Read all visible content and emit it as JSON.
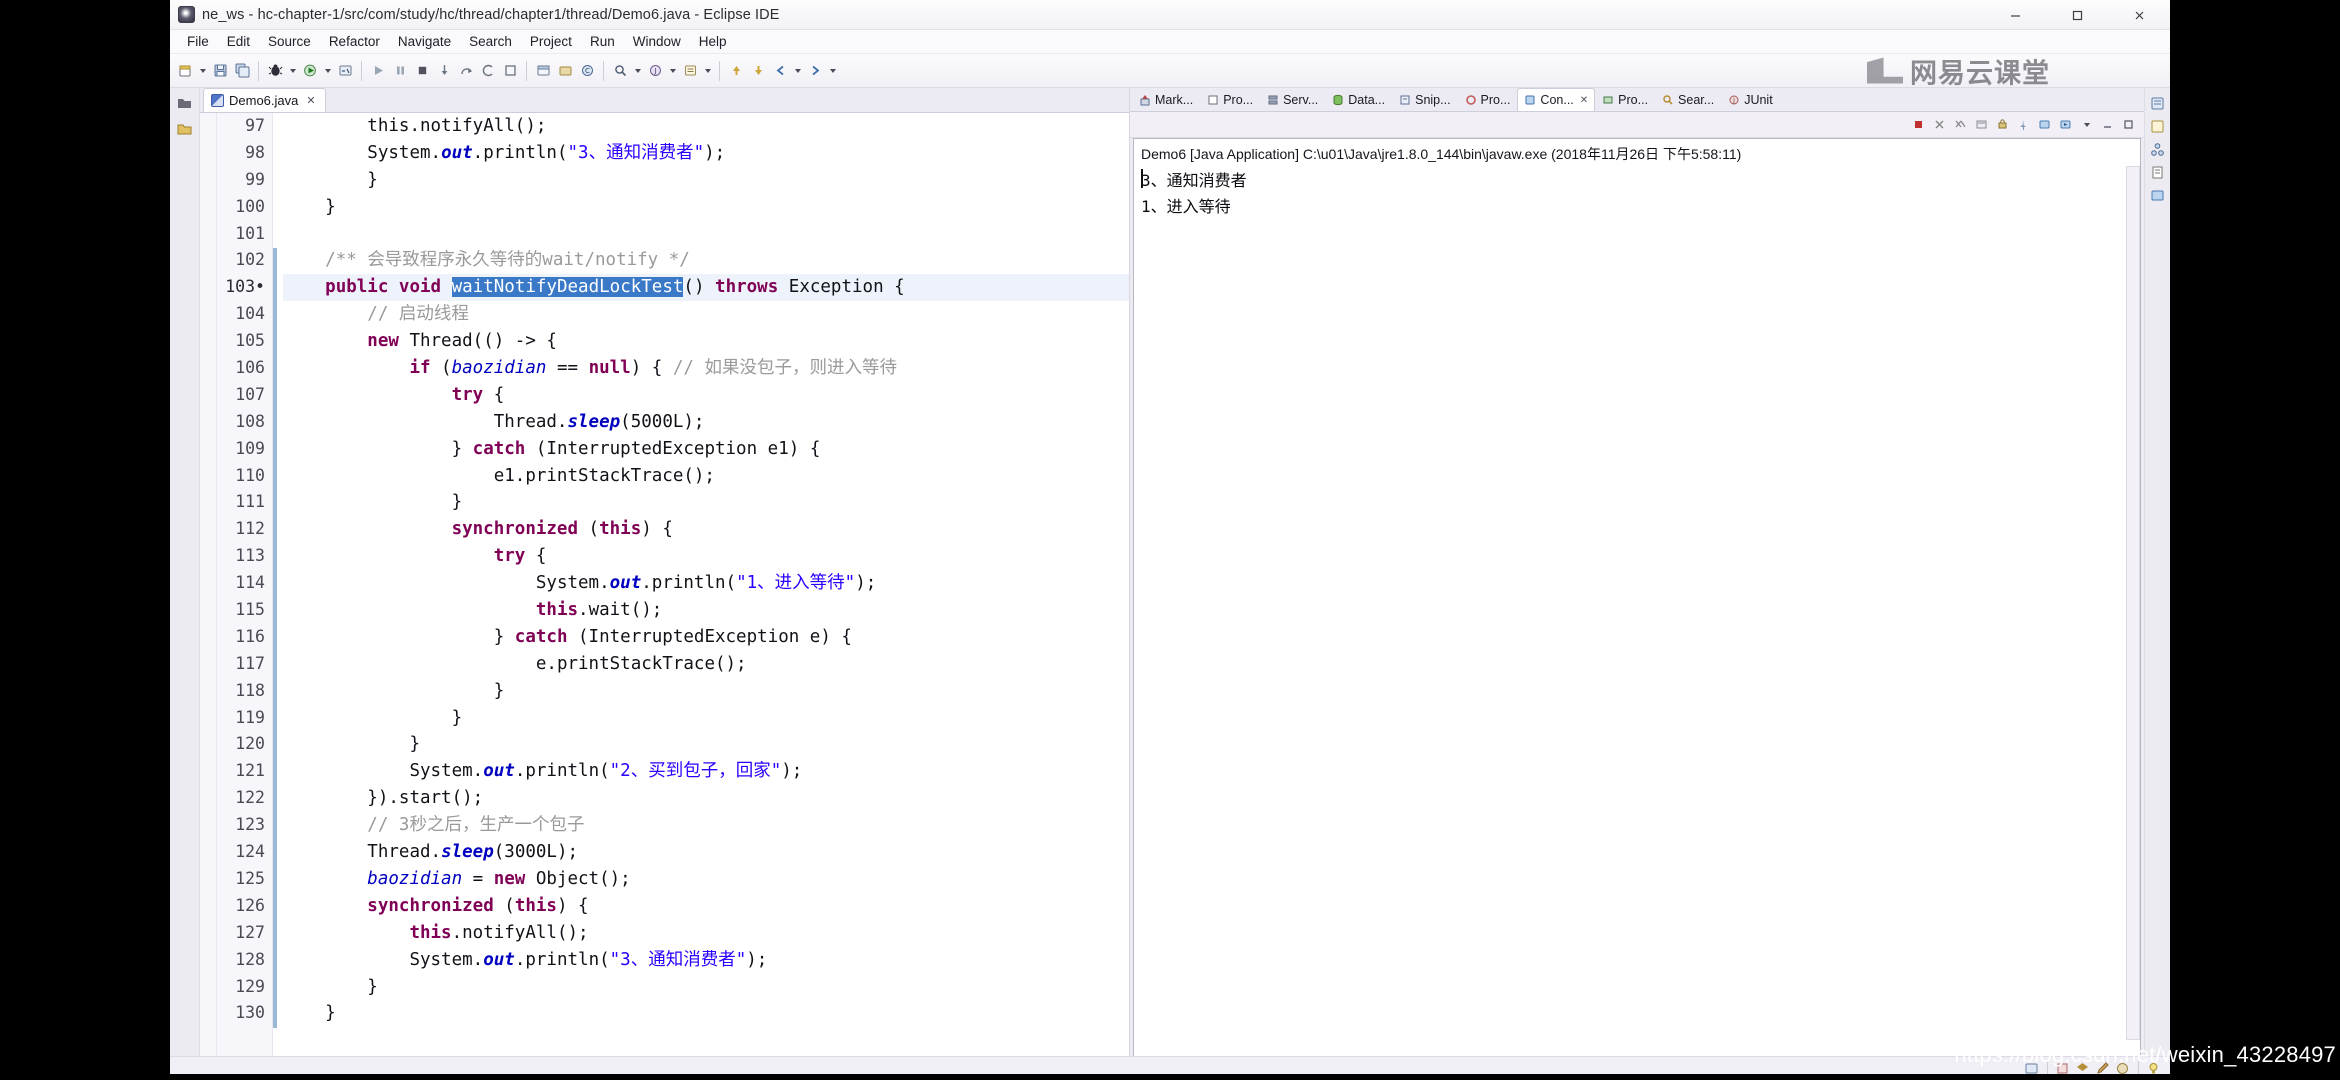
{
  "window": {
    "title": "ne_ws - hc-chapter-1/src/com/study/hc/thread/chapter1/thread/Demo6.java - Eclipse IDE",
    "app_icon": "eclipse-icon",
    "minimize": "—",
    "maximize": "☐",
    "close": "✕"
  },
  "menubar": {
    "items": [
      {
        "label": "File"
      },
      {
        "label": "Edit"
      },
      {
        "label": "Source"
      },
      {
        "label": "Refactor"
      },
      {
        "label": "Navigate"
      },
      {
        "label": "Search"
      },
      {
        "label": "Project"
      },
      {
        "label": "Run"
      },
      {
        "label": "Window"
      },
      {
        "label": "Help"
      }
    ]
  },
  "watermarks": {
    "brand_text": "网易云课堂",
    "brand_icon": "open-book-icon",
    "blog_url": "https://blog.csdn.net/weixin_43228497"
  },
  "editor": {
    "tab": {
      "label": "Demo6.java",
      "icon": "java-file-icon",
      "close": "✕"
    },
    "selected_text": "waitNotifyDeadLockTest",
    "lines": [
      {
        "num": "97",
        "marker": "",
        "indent": 2,
        "tokens": [
          {
            "t": "this.",
            "c": "cl"
          },
          {
            "t": "notifyAll();",
            "c": "cl"
          }
        ]
      },
      {
        "num": "98",
        "marker": "",
        "indent": 2,
        "tokens": [
          {
            "t": "System.",
            "c": "cl"
          },
          {
            "t": "out",
            "c": "stc"
          },
          {
            "t": ".println(",
            "c": "cl"
          },
          {
            "t": "\"3、通知消费者\"",
            "c": "str"
          },
          {
            "t": ");",
            "c": "cl"
          }
        ]
      },
      {
        "num": "99",
        "marker": "",
        "indent": 2,
        "tokens": [
          {
            "t": "}",
            "c": "cl"
          }
        ]
      },
      {
        "num": "100",
        "marker": "",
        "indent": 1,
        "tokens": [
          {
            "t": "}",
            "c": "cl"
          }
        ]
      },
      {
        "num": "101",
        "marker": "",
        "indent": 0,
        "tokens": []
      },
      {
        "num": "102",
        "marker": "",
        "indent": 1,
        "tokens": [
          {
            "t": "/** ",
            "c": "doc"
          },
          {
            "t": "会导致程序永久等待的wait/notify */",
            "c": "doc"
          }
        ]
      },
      {
        "num": "103",
        "marker": "•",
        "indent": 1,
        "current": true,
        "tokens": [
          {
            "t": "public",
            "c": "kw"
          },
          {
            "t": " ",
            "c": "cl"
          },
          {
            "t": "void",
            "c": "kw"
          },
          {
            "t": " ",
            "c": "cl"
          },
          {
            "t": "waitNotifyDeadLockTest",
            "c": "sel"
          },
          {
            "t": "() ",
            "c": "cl"
          },
          {
            "t": "throws",
            "c": "kw"
          },
          {
            "t": " Exception {",
            "c": "cl"
          }
        ]
      },
      {
        "num": "104",
        "marker": "",
        "indent": 2,
        "tokens": [
          {
            "t": "// 启动线程",
            "c": "cmt"
          }
        ]
      },
      {
        "num": "105",
        "marker": "",
        "indent": 2,
        "tokens": [
          {
            "t": "new",
            "c": "kw"
          },
          {
            "t": " Thread(() -> {",
            "c": "cl"
          }
        ]
      },
      {
        "num": "106",
        "marker": "",
        "indent": 3,
        "tokens": [
          {
            "t": "if",
            "c": "kw"
          },
          {
            "t": " (",
            "c": "cl"
          },
          {
            "t": "baozidian",
            "c": "fld"
          },
          {
            "t": " == ",
            "c": "cl"
          },
          {
            "t": "null",
            "c": "kw"
          },
          {
            "t": ") { ",
            "c": "cl"
          },
          {
            "t": "// 如果没包子，则进入等待",
            "c": "cmt"
          }
        ]
      },
      {
        "num": "107",
        "marker": "",
        "indent": 4,
        "tokens": [
          {
            "t": "try",
            "c": "kw"
          },
          {
            "t": " {",
            "c": "cl"
          }
        ]
      },
      {
        "num": "108",
        "marker": "",
        "indent": 5,
        "tokens": [
          {
            "t": "Thread.",
            "c": "cl"
          },
          {
            "t": "sleep",
            "c": "stc"
          },
          {
            "t": "(5000L);",
            "c": "cl"
          }
        ]
      },
      {
        "num": "109",
        "marker": "",
        "indent": 4,
        "tokens": [
          {
            "t": "} ",
            "c": "cl"
          },
          {
            "t": "catch",
            "c": "kw"
          },
          {
            "t": " (InterruptedException e1) {",
            "c": "cl"
          }
        ]
      },
      {
        "num": "110",
        "marker": "",
        "indent": 5,
        "tokens": [
          {
            "t": "e1.printStackTrace();",
            "c": "cl"
          }
        ]
      },
      {
        "num": "111",
        "marker": "",
        "indent": 4,
        "tokens": [
          {
            "t": "}",
            "c": "cl"
          }
        ]
      },
      {
        "num": "112",
        "marker": "",
        "indent": 4,
        "tokens": [
          {
            "t": "synchronized",
            "c": "kw"
          },
          {
            "t": " (",
            "c": "cl"
          },
          {
            "t": "this",
            "c": "kw"
          },
          {
            "t": ") {",
            "c": "cl"
          }
        ]
      },
      {
        "num": "113",
        "marker": "",
        "indent": 5,
        "tokens": [
          {
            "t": "try",
            "c": "kw"
          },
          {
            "t": " {",
            "c": "cl"
          }
        ]
      },
      {
        "num": "114",
        "marker": "",
        "indent": 6,
        "tokens": [
          {
            "t": "System.",
            "c": "cl"
          },
          {
            "t": "out",
            "c": "stc"
          },
          {
            "t": ".println(",
            "c": "cl"
          },
          {
            "t": "\"1、进入等待\"",
            "c": "str"
          },
          {
            "t": ");",
            "c": "cl"
          }
        ]
      },
      {
        "num": "115",
        "marker": "",
        "indent": 6,
        "tokens": [
          {
            "t": "this",
            "c": "kw"
          },
          {
            "t": ".wait();",
            "c": "cl"
          }
        ]
      },
      {
        "num": "116",
        "marker": "",
        "indent": 5,
        "tokens": [
          {
            "t": "} ",
            "c": "cl"
          },
          {
            "t": "catch",
            "c": "kw"
          },
          {
            "t": " (InterruptedException e) {",
            "c": "cl"
          }
        ]
      },
      {
        "num": "117",
        "marker": "",
        "indent": 6,
        "tokens": [
          {
            "t": "e.printStackTrace();",
            "c": "cl"
          }
        ]
      },
      {
        "num": "118",
        "marker": "",
        "indent": 5,
        "tokens": [
          {
            "t": "}",
            "c": "cl"
          }
        ]
      },
      {
        "num": "119",
        "marker": "",
        "indent": 4,
        "tokens": [
          {
            "t": "}",
            "c": "cl"
          }
        ]
      },
      {
        "num": "120",
        "marker": "",
        "indent": 3,
        "tokens": [
          {
            "t": "}",
            "c": "cl"
          }
        ]
      },
      {
        "num": "121",
        "marker": "",
        "indent": 3,
        "tokens": [
          {
            "t": "System.",
            "c": "cl"
          },
          {
            "t": "out",
            "c": "stc"
          },
          {
            "t": ".println(",
            "c": "cl"
          },
          {
            "t": "\"2、买到包子，回家\"",
            "c": "str"
          },
          {
            "t": ");",
            "c": "cl"
          }
        ]
      },
      {
        "num": "122",
        "marker": "",
        "indent": 2,
        "tokens": [
          {
            "t": "}).start();",
            "c": "cl"
          }
        ]
      },
      {
        "num": "123",
        "marker": "",
        "indent": 2,
        "tokens": [
          {
            "t": "// 3秒之后，生产一个包子",
            "c": "cmt"
          }
        ]
      },
      {
        "num": "124",
        "marker": "",
        "indent": 2,
        "tokens": [
          {
            "t": "Thread.",
            "c": "cl"
          },
          {
            "t": "sleep",
            "c": "stc"
          },
          {
            "t": "(3000L);",
            "c": "cl"
          }
        ]
      },
      {
        "num": "125",
        "marker": "",
        "indent": 2,
        "tokens": [
          {
            "t": "baozidian",
            "c": "fld"
          },
          {
            "t": " = ",
            "c": "cl"
          },
          {
            "t": "new",
            "c": "kw"
          },
          {
            "t": " Object();",
            "c": "cl"
          }
        ]
      },
      {
        "num": "126",
        "marker": "",
        "indent": 2,
        "tokens": [
          {
            "t": "synchronized",
            "c": "kw"
          },
          {
            "t": " (",
            "c": "cl"
          },
          {
            "t": "this",
            "c": "kw"
          },
          {
            "t": ") {",
            "c": "cl"
          }
        ]
      },
      {
        "num": "127",
        "marker": "",
        "indent": 3,
        "tokens": [
          {
            "t": "this",
            "c": "kw"
          },
          {
            "t": ".notifyAll();",
            "c": "cl"
          }
        ]
      },
      {
        "num": "128",
        "marker": "",
        "indent": 3,
        "tokens": [
          {
            "t": "System.",
            "c": "cl"
          },
          {
            "t": "out",
            "c": "stc"
          },
          {
            "t": ".println(",
            "c": "cl"
          },
          {
            "t": "\"3、通知消费者\"",
            "c": "str"
          },
          {
            "t": ");",
            "c": "cl"
          }
        ]
      },
      {
        "num": "129",
        "marker": "",
        "indent": 2,
        "tokens": [
          {
            "t": "}",
            "c": "cl"
          }
        ]
      },
      {
        "num": "130",
        "marker": "",
        "indent": 1,
        "tokens": [
          {
            "t": "}",
            "c": "cl"
          }
        ]
      }
    ]
  },
  "dock": {
    "tabs": [
      {
        "label": "Mark...",
        "icon": "marker-icon",
        "active": false
      },
      {
        "label": "Pro...",
        "icon": "problems-icon",
        "active": false
      },
      {
        "label": "Serv...",
        "icon": "servers-icon",
        "active": false
      },
      {
        "label": "Data...",
        "icon": "data-source-icon",
        "active": false
      },
      {
        "label": "Snip...",
        "icon": "snippets-icon",
        "active": false
      },
      {
        "label": "Pro...",
        "icon": "progress-icon",
        "active": false
      },
      {
        "label": "Con...",
        "icon": "console-icon",
        "active": true
      },
      {
        "label": "Pro...",
        "icon": "properties-icon",
        "active": false
      },
      {
        "label": "Sear...",
        "icon": "search-icon",
        "active": false
      },
      {
        "label": "JUnit",
        "icon": "junit-icon",
        "active": false
      }
    ],
    "console": {
      "header": "Demo6 [Java Application] C:\\u01\\Java\\jre1.8.0_144\\bin\\javaw.exe (2018年11月26日 下午5:58:11)",
      "output": [
        "3、通知消费者",
        "1、进入等待"
      ]
    }
  },
  "colors": {
    "keyword": "#7f0055",
    "string": "#2a00ff",
    "comment": "#9a9a9a",
    "field": "#0000c0",
    "selection": "#3a78c8",
    "chrome": "#f1eff6"
  }
}
